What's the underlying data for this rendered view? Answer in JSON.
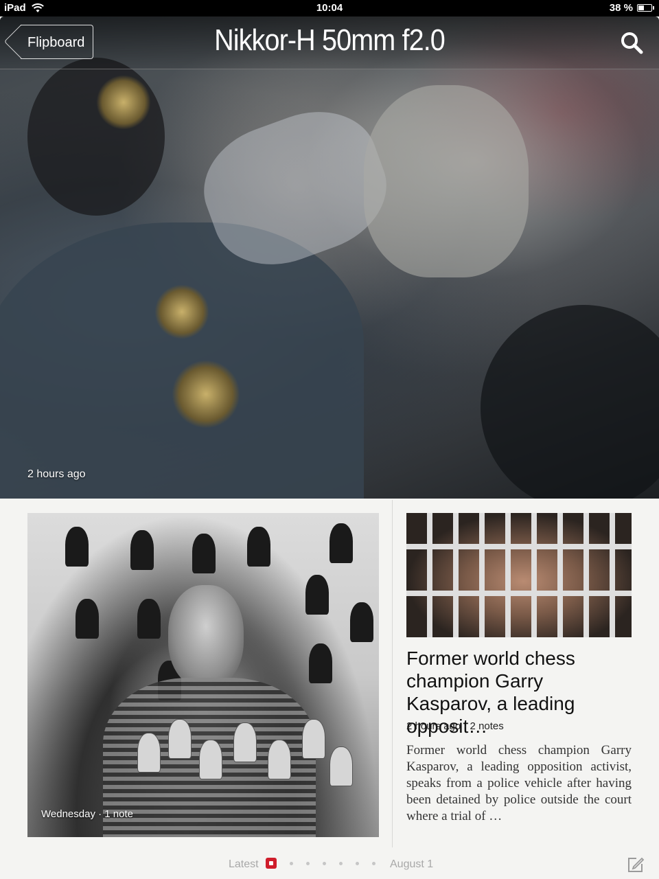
{
  "status_bar": {
    "device": "iPad",
    "time": "10:04",
    "battery": "38 %",
    "battery_level": 0.38,
    "icons": [
      "wifi-icon",
      "battery-icon"
    ]
  },
  "header": {
    "back_label": "Flipboard",
    "title": "Nikkor-H 50mm f2.0",
    "search_icon": "search-icon"
  },
  "hero": {
    "timestamp": "2 hours ago"
  },
  "cards": [
    {
      "caption": "Wednesday · 1 note"
    },
    {
      "headline": "Former world chess champion Garry Kasparov, a leading opposit…",
      "meta": "2 hours ago · 2 notes",
      "excerpt": "Former world chess champion Garry Kasparov, a leading opposition activist, speaks from a police vehicle after having been detained by police outside the court where a trial of …"
    }
  ],
  "pagination": {
    "start_label": "Latest",
    "end_label": "August 1",
    "total_pages": 7,
    "current_page": 1
  },
  "footer": {
    "compose_icon": "compose-icon"
  },
  "colors": {
    "accent": "#cf1d2b",
    "page_background": "#f4f4f2"
  }
}
